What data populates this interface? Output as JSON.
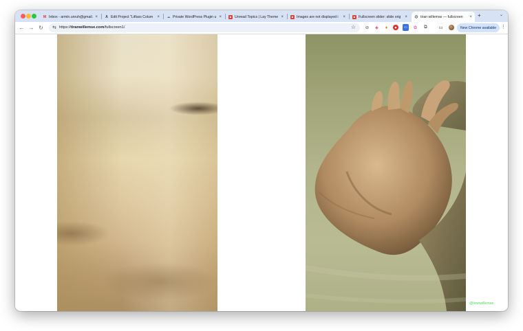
{
  "browser": {
    "tabs": [
      {
        "label": "Inbox - armin.unruh@gmail.",
        "icon": "gmail-icon",
        "active": false
      },
      {
        "label": "Edit Project \"Litfass Colum",
        "icon": "lay-theme-icon",
        "active": false
      },
      {
        "label": "Private WordPress Plugin u",
        "icon": "plugin-icon",
        "active": false
      },
      {
        "label": "Unread Topics | Lay Theme",
        "icon": "forum-icon",
        "active": false
      },
      {
        "label": "Images are not displayed i",
        "icon": "forum-icon",
        "active": false
      },
      {
        "label": "Fullscreen slider: slide orig",
        "icon": "forum-icon",
        "active": false
      },
      {
        "label": "tiran willemse — fullscreen",
        "icon": "globe-icon",
        "active": true
      }
    ],
    "new_tab_glyph": "+",
    "tab_close_glyph": "×",
    "url_prefix": "https://",
    "url_host": "tiranwillemse.com",
    "url_path": "/fullscreen1/",
    "new_chrome_label": "New Chrome available",
    "colors": {
      "tabbar": "#d8e2f5",
      "accent_button": "#d3e3fd"
    }
  },
  "page": {
    "credit_text": "@tiranwillemse"
  }
}
